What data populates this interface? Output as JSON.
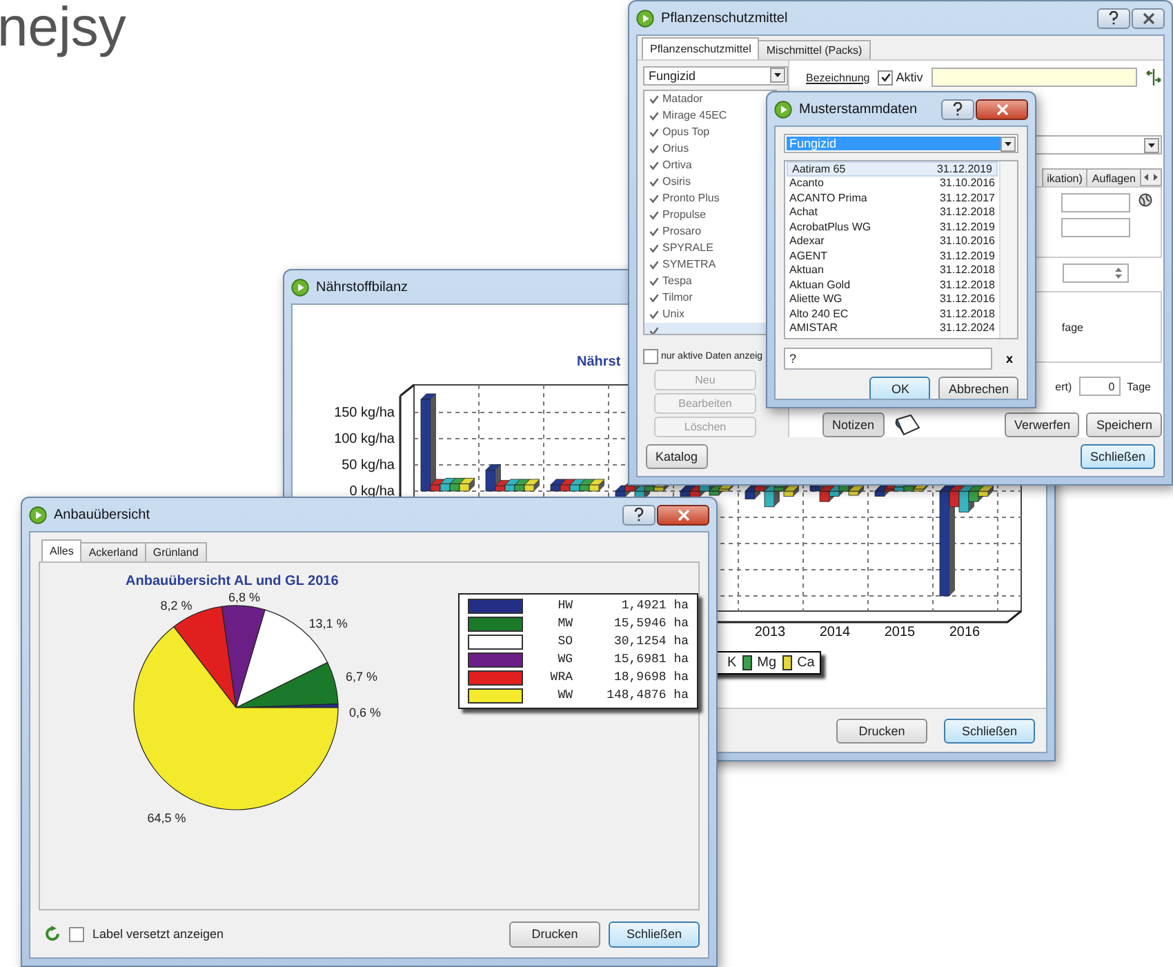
{
  "slide_heading": "nejsy",
  "nutrient_window": {
    "title": "Nährstoffbilanz",
    "chart_title": "Nährst",
    "y_tick_labels": [
      "150 kg/ha",
      "100 kg/ha",
      "50 kg/ha",
      "0 kg/ha"
    ],
    "x_tick_labels": [
      "2013",
      "2014",
      "2015",
      "2016"
    ],
    "legend": [
      {
        "label": "K"
      },
      {
        "label": "Mg",
        "color": "#3aa24a"
      },
      {
        "label": "Ca",
        "color": "#e5d838"
      }
    ],
    "buttons": [
      {
        "label": "Drucken",
        "default": false
      },
      {
        "label": "Schließen",
        "default": true
      }
    ]
  },
  "plant_protection_window": {
    "title": "Pflanzenschutzmittel",
    "tabs": [
      {
        "label": "Pflanzenschutzmittel",
        "selected": true
      },
      {
        "label": "Mischmittel (Packs)",
        "selected": false
      }
    ],
    "category_select": {
      "value": "Fungizid"
    },
    "products": [
      {
        "name": "Matador",
        "checked": true,
        "selected": false
      },
      {
        "name": "Mirage 45EC",
        "checked": true,
        "selected": false
      },
      {
        "name": "Opus Top",
        "checked": true,
        "selected": false
      },
      {
        "name": "Orius",
        "checked": true,
        "selected": false
      },
      {
        "name": "Ortiva",
        "checked": true,
        "selected": false
      },
      {
        "name": "Osiris",
        "checked": true,
        "selected": false
      },
      {
        "name": "Pronto Plus",
        "checked": true,
        "selected": false
      },
      {
        "name": "Propulse",
        "checked": true,
        "selected": false
      },
      {
        "name": "Prosaro",
        "checked": true,
        "selected": false
      },
      {
        "name": "SPYRALE",
        "checked": true,
        "selected": false
      },
      {
        "name": "SYMETRA",
        "checked": true,
        "selected": false
      },
      {
        "name": "Tespa",
        "checked": true,
        "selected": false
      },
      {
        "name": "Tilmor",
        "checked": true,
        "selected": false
      },
      {
        "name": "Unix",
        "checked": true,
        "selected": false
      },
      {
        "checked": true,
        "selected": true
      }
    ],
    "active_only": {
      "label": "nur aktive Daten anzeig",
      "checked": false
    },
    "side_buttons": [
      {
        "label": "Neu",
        "disabled": true
      },
      {
        "label": "Bearbeiten",
        "disabled": true
      },
      {
        "label": "Löschen",
        "disabled": true
      }
    ],
    "name_label": "Bezeichnung",
    "active": {
      "label": "Aktiv",
      "checked": true
    },
    "detail_tabs": [
      {
        "label": "ikation)",
        "selected": false
      },
      {
        "label": "Auflagen",
        "selected": false
      }
    ],
    "requirement_label": "fage",
    "wait_label": "ert)",
    "wait_value": "0",
    "wait_unit": "Tage",
    "notes_button": "Notizen",
    "detail_buttons": [
      {
        "label": "Verwerfen"
      },
      {
        "label": "Speichern"
      }
    ],
    "catalog_button": "Katalog",
    "close_button": {
      "label": "Schließen",
      "default": true
    }
  },
  "master_data_dialog": {
    "title": "Musterstammdaten",
    "category_select": {
      "value": "Fungizid",
      "focused": true
    },
    "rows": [
      {
        "name": "Aatiram 65",
        "date": "31.12.2019",
        "selected": true
      },
      {
        "name": "Acanto",
        "date": "31.10.2016",
        "selected": false
      },
      {
        "name": "ACANTO Prima",
        "date": "31.12.2017",
        "selected": false
      },
      {
        "name": "Achat",
        "date": "31.12.2018",
        "selected": false
      },
      {
        "name": "AcrobatPlus WG",
        "date": "31.12.2019",
        "selected": false
      },
      {
        "name": "Adexar",
        "date": "31.10.2016",
        "selected": false
      },
      {
        "name": "AGENT",
        "date": "31.12.2019",
        "selected": false
      },
      {
        "name": "Aktuan",
        "date": "31.12.2018",
        "selected": false
      },
      {
        "name": "Aktuan Gold",
        "date": "31.12.2018",
        "selected": false
      },
      {
        "name": "Aliette WG",
        "date": "31.12.2016",
        "selected": false
      },
      {
        "name": "Alto 240 EC",
        "date": "31.12.2018",
        "selected": false
      },
      {
        "name": "AMISTAR",
        "date": "31.12.2024",
        "selected": false
      }
    ],
    "search": {
      "value": "?"
    },
    "clear_button": "x",
    "buttons": [
      {
        "label": "OK",
        "default": true
      },
      {
        "label": "Abbrechen",
        "default": false
      }
    ]
  },
  "cultivation_window": {
    "title": "Anbauübersicht",
    "tabs": [
      {
        "label": "Alles",
        "selected": true
      },
      {
        "label": "Ackerland",
        "selected": false
      },
      {
        "label": "Grünland",
        "selected": false
      }
    ],
    "chart_data": {
      "type": "pie",
      "title": "Anbauübersicht AL und GL 2016",
      "categories": [
        "HW",
        "MW",
        "SO",
        "WG",
        "WRA",
        "WW"
      ],
      "values": [
        0.6,
        6.7,
        13.1,
        6.8,
        8.2,
        64.5
      ],
      "value_labels": [
        "0,6 %",
        "6,7 %",
        "13,1 %",
        "6,8 %",
        "8,2 %",
        "64,5 %"
      ]
    },
    "legend": [
      {
        "area": "1,4921 ha",
        "color": "#232f86"
      },
      {
        "area": "15,5946 ha",
        "color": "#1b7a2a"
      },
      {
        "area": "30,1254 ha",
        "color": "#ffffff"
      },
      {
        "area": "15,6981 ha",
        "color": "#6b1f86"
      },
      {
        "area": "18,9698 ha",
        "color": "#e21f1f"
      },
      {
        "area": "148,4876 ha",
        "color": "#f2ea2a"
      }
    ],
    "label_offset": {
      "label": "Label versetzt anzeigen",
      "checked": false
    },
    "buttons": [
      {
        "label": "Drucken",
        "default": false
      },
      {
        "label": "Schließen",
        "default": true
      }
    ]
  }
}
